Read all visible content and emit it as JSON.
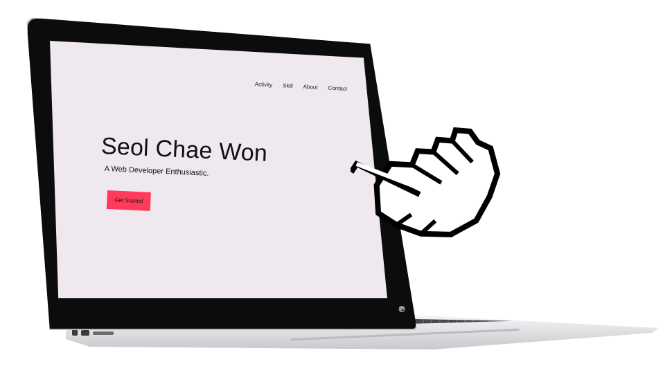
{
  "site": {
    "nav": {
      "items": [
        {
          "label": "Activity"
        },
        {
          "label": "Skill"
        },
        {
          "label": "About"
        },
        {
          "label": "Contact"
        }
      ]
    },
    "hero": {
      "name": "Seol Chae Won",
      "tagline": "A Web Developer Enthusiastic.",
      "cta_label": "Get Started"
    }
  },
  "device": {
    "brand_mark": "℗"
  },
  "icons": {
    "cursor": "pointing-hand-cursor-icon",
    "camera": "webcam-icon"
  },
  "colors": {
    "screen_background": "#efe8ef",
    "cta_background": "#ff3b5c",
    "text": "#111111",
    "bezel": "#0c0c0d"
  }
}
